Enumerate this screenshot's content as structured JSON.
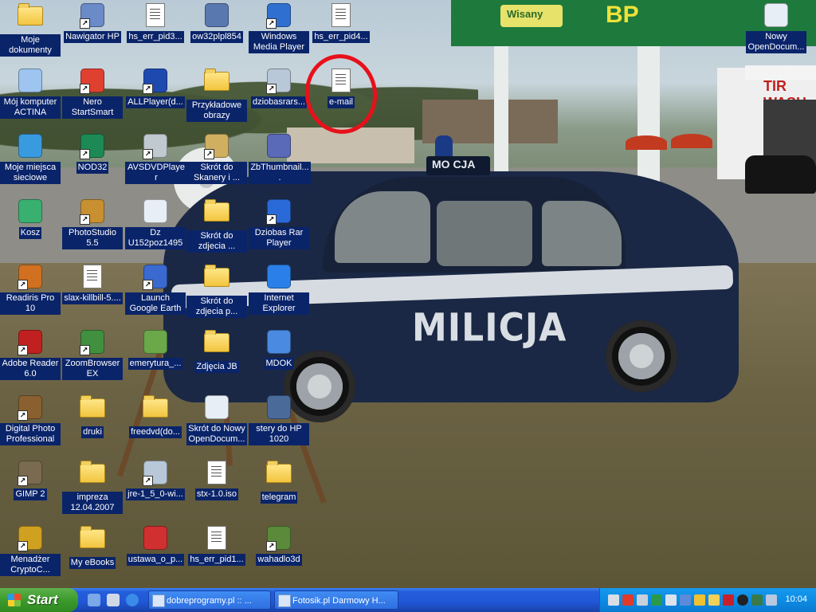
{
  "desktop": {
    "icons": [
      {
        "label": "Moje dokumenty",
        "icon": "my-documents-icon"
      },
      {
        "label": "Nawigator HP",
        "icon": "hp-navigator-icon"
      },
      {
        "label": "hs_err_pid3...",
        "icon": "text-file-icon"
      },
      {
        "label": "ow32plpl854",
        "icon": "setup-icon"
      },
      {
        "label": "Windows Media Player",
        "icon": "media-player-icon"
      },
      {
        "label": "hs_err_pid4...",
        "icon": "text-file-icon"
      },
      {
        "label": "Nowy OpenDocum...",
        "icon": "opendocument-icon"
      },
      {
        "label": "Mój komputer ACTINA",
        "icon": "my-computer-icon"
      },
      {
        "label": "Nero StartSmart",
        "icon": "nero-icon"
      },
      {
        "label": "ALLPlayer(d...",
        "icon": "allplayer-icon"
      },
      {
        "label": "Przykładowe obrazy",
        "icon": "folder-icon"
      },
      {
        "label": "dziobasrars...",
        "icon": "installer-icon"
      },
      {
        "label": "e-mail",
        "icon": "text-file-icon"
      },
      {
        "label": "Moje miejsca sieciowe",
        "icon": "network-places-icon"
      },
      {
        "label": "NOD32",
        "icon": "nod32-icon"
      },
      {
        "label": "AVSDVDPlayer",
        "icon": "dvd-player-icon"
      },
      {
        "label": "Skrót do Skanery i ...",
        "icon": "scanner-icon"
      },
      {
        "label": "ZbThumbnail....",
        "icon": "thumbnail-icon"
      },
      {
        "label": "Kosz",
        "icon": "recycle-bin-icon"
      },
      {
        "label": "PhotoStudio 5.5",
        "icon": "photostudio-icon"
      },
      {
        "label": "Dz U152poz1495",
        "icon": "opendocument-icon"
      },
      {
        "label": "Skrót do zdjecia ...",
        "icon": "folder-icon"
      },
      {
        "label": "Dziobas Rar Player",
        "icon": "rar-player-icon"
      },
      {
        "label": "Readiris Pro 10",
        "icon": "readiris-icon"
      },
      {
        "label": "slax-killbill-5....",
        "icon": "image-file-icon"
      },
      {
        "label": "Launch Google Earth",
        "icon": "google-earth-icon"
      },
      {
        "label": "Skrót do zdjecia p...",
        "icon": "folder-icon"
      },
      {
        "label": "Internet Explorer",
        "icon": "internet-explorer-icon"
      },
      {
        "label": "Adobe Reader 6.0",
        "icon": "adobe-reader-icon"
      },
      {
        "label": "ZoomBrowser EX",
        "icon": "zoombrowser-icon"
      },
      {
        "label": "emerytura_...",
        "icon": "spreadsheet-icon"
      },
      {
        "label": "Zdjęcia JB",
        "icon": "folder-icon"
      },
      {
        "label": "MDOK",
        "icon": "ie-document-icon"
      },
      {
        "label": "Digital Photo Professional",
        "icon": "digital-photo-icon"
      },
      {
        "label": "druki",
        "icon": "folder-icon"
      },
      {
        "label": "freedvd(do...",
        "icon": "zip-folder-icon"
      },
      {
        "label": "Skrót do Nowy OpenDocum...",
        "icon": "opendocument-icon"
      },
      {
        "label": "stery do HP 1020",
        "icon": "hp-driver-icon"
      },
      {
        "label": "GIMP 2",
        "icon": "gimp-icon"
      },
      {
        "label": "impreza 12.04.2007",
        "icon": "folder-icon"
      },
      {
        "label": "jre-1_5_0-wi...",
        "icon": "installer-icon"
      },
      {
        "label": "stx-1.0.iso",
        "icon": "iso-file-icon"
      },
      {
        "label": "telegram",
        "icon": "folder-icon"
      },
      {
        "label": "Menadżer CryptoC...",
        "icon": "crypto-icon"
      },
      {
        "label": "My eBooks",
        "icon": "folder-icon"
      },
      {
        "label": "ustawa_o_p...",
        "icon": "pdf-icon"
      },
      {
        "label": "hs_err_pid1...",
        "icon": "text-file-icon"
      },
      {
        "label": "wahadlo3d",
        "icon": "pendulum-icon"
      }
    ]
  },
  "wallpaper": {
    "station_sign": "Wisany",
    "brand": "BP",
    "carwash_sign": "TIR WASH",
    "car_roof_sign": "MO CJA",
    "car_side_text": "MILICJA"
  },
  "taskbar": {
    "start_label": "Start",
    "windows": [
      {
        "label": "dobreprogramy.pl :: ..."
      },
      {
        "label": "Fotosik.pl Darmowy H..."
      }
    ],
    "clock": "10:04"
  },
  "colors": {
    "label_bg": "#0a246a",
    "taskbar": "#245edb",
    "start_button": "#3c9a2c",
    "tray": "#0d8fe6",
    "highlight_circle": "#e8101a"
  }
}
